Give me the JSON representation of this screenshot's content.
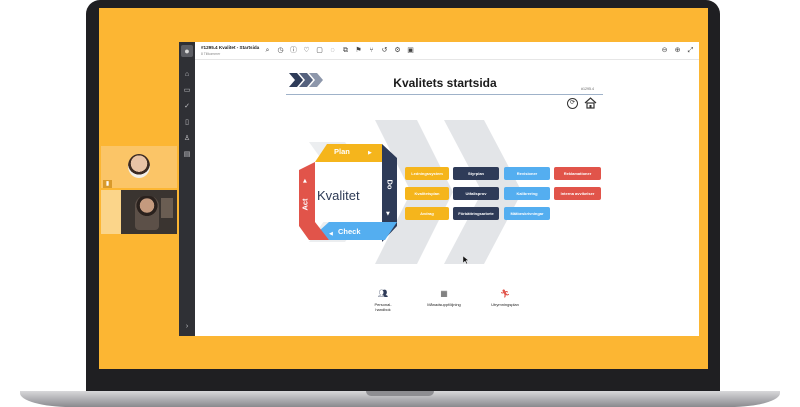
{
  "window": {
    "title": "#1295.4 Kvalitet - Startsida",
    "subtitle": "8 Tillkommer"
  },
  "page": {
    "title": "Kvalitets startsida",
    "page_id": "#1295.4"
  },
  "cycle": {
    "center_label": "Kvalitet",
    "plan": "Plan",
    "do": "Do",
    "check": "Check",
    "act": "Act",
    "colors": {
      "plan": "#f5b51c",
      "do": "#2e3b58",
      "check": "#54aef0",
      "act": "#e1544a"
    }
  },
  "process_buttons": {
    "yellow": [
      "Ledningssystem",
      "Kvalitetsplan",
      "Avdrag"
    ],
    "navy": [
      "Styrplan",
      "Utfallsprov",
      "Förbättringsarbete"
    ],
    "blue": [
      "Revisioner",
      "Kalibrering",
      "Mätbeskrivningar"
    ],
    "red": [
      "Reklamationer",
      "Interna avvikelser"
    ]
  },
  "quick_links": [
    {
      "icon": "people-icon",
      "label": "Personal-\nhandbok"
    },
    {
      "icon": "calendar-icon",
      "label": "Månadsuppföljning"
    },
    {
      "icon": "evacuation-icon",
      "label": "Utrymningsplan"
    }
  ],
  "sidebar": {
    "collapse_label": "›"
  }
}
